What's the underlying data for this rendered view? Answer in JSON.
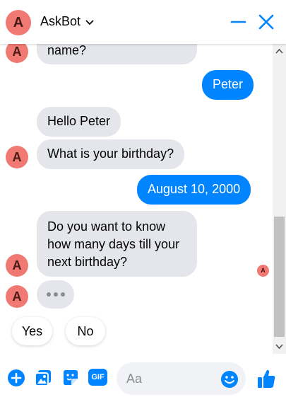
{
  "header": {
    "avatar_letter": "A",
    "title": "AskBot",
    "icons": [
      "chevron-down-icon",
      "minimize-icon",
      "close-icon"
    ]
  },
  "messages": [
    {
      "from": "bot",
      "text": "name?"
    },
    {
      "from": "user",
      "text": "Peter"
    },
    {
      "from": "bot",
      "text": "Hello Peter"
    },
    {
      "from": "bot",
      "text": "What is your birthday?"
    },
    {
      "from": "user",
      "text": "August 10, 2000"
    },
    {
      "from": "bot",
      "text": "Do you want to know how many days till your next birthday?"
    }
  ],
  "quick_replies": [
    "Yes",
    "No"
  ],
  "read_receipt_letter": "A",
  "composer": {
    "placeholder": "Aa",
    "icons": [
      "plus-icon",
      "photo-icon",
      "sticker-icon",
      "gif-icon",
      "emoji-icon",
      "thumbs-up-icon"
    ],
    "gif_label": "GIF"
  },
  "colors": {
    "accent": "#0084ff",
    "avatar": "#f07a73",
    "bot_bubble": "#e4e6eb"
  }
}
